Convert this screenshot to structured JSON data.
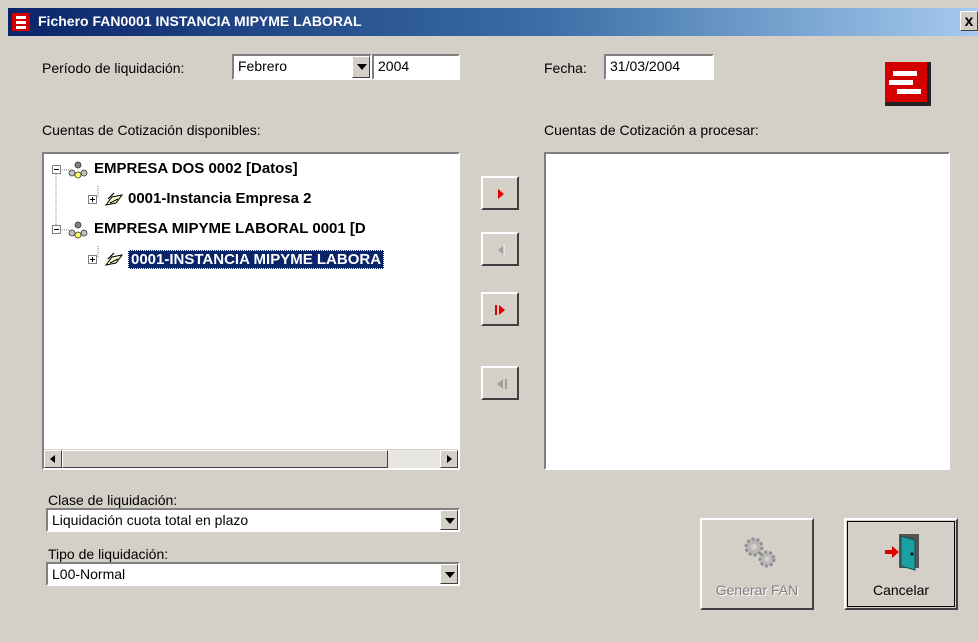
{
  "window": {
    "title": "Fichero FAN0001 INSTANCIA MIPYME LABORAL",
    "close_label": "x"
  },
  "periodo": {
    "label": "Período de liquidación:",
    "month": "Febrero",
    "year": "2004"
  },
  "fecha": {
    "label": "Fecha:",
    "value": "31/03/2004"
  },
  "available": {
    "label": "Cuentas de Cotización disponibles:",
    "items": [
      {
        "text": "EMPRESA DOS 0002 [Datos]",
        "level": 0,
        "expander": "minus",
        "icon": "company-icon"
      },
      {
        "text": "0001-Instancia Empresa 2",
        "level": 1,
        "expander": "plus",
        "icon": "account-icon"
      },
      {
        "text": "EMPRESA MIPYME LABORAL 0001 [D",
        "level": 0,
        "expander": "minus",
        "icon": "company-icon"
      },
      {
        "text": "0001-INSTANCIA MIPYME LABORA",
        "level": 1,
        "expander": "plus",
        "icon": "account-icon",
        "selected": true
      }
    ]
  },
  "to_process": {
    "label": "Cuentas de Cotización a procesar:"
  },
  "move_buttons": {
    "add_one": "move-right-icon",
    "remove_one": "move-left-icon",
    "add_all": "move-all-right-icon",
    "remove_all": "move-all-left-icon"
  },
  "clase": {
    "label": "Clase de liquidación:",
    "value": "Liquidación cuota total en plazo"
  },
  "tipo": {
    "label": "Tipo de liquidación:",
    "value": "L00-Normal"
  },
  "actions": {
    "generate_label": "Generar FAN",
    "cancel_label": "Cancelar"
  },
  "colors": {
    "accent": "#d40000",
    "title_bar": "#0a246a",
    "selection": "#0a246a",
    "face": "#d4d0c8"
  }
}
